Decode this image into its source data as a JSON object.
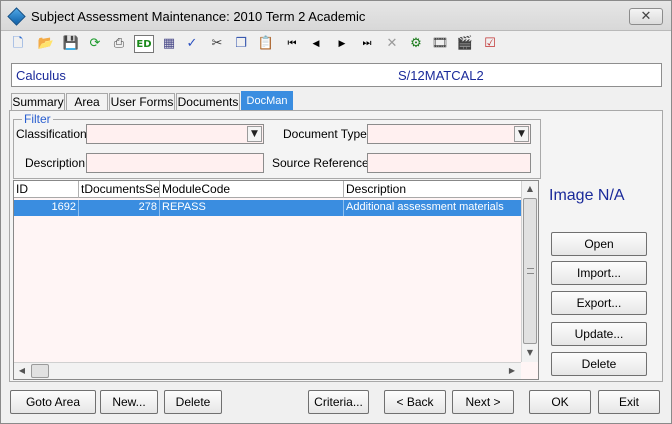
{
  "window": {
    "title": "Subject Assessment Maintenance:  2010 Term 2 Academic",
    "close_glyph": "✕"
  },
  "toolbar": [
    {
      "name": "new-icon",
      "glyph": "🗋",
      "color": "#2a6ad0"
    },
    {
      "name": "open-folder-icon",
      "glyph": "📂",
      "color": "#d4a020"
    },
    {
      "name": "save-icon",
      "glyph": "💾",
      "color": "#9a9a9a"
    },
    {
      "name": "refresh-icon",
      "glyph": "⟳",
      "color": "#1a9a2a"
    },
    {
      "name": "print-icon",
      "glyph": "⎙",
      "color": "#444444"
    },
    {
      "name": "edit-icon",
      "glyph": "ED",
      "color": "#1a8a1a"
    },
    {
      "name": "calculator-icon",
      "glyph": "▦",
      "color": "#4a4a8a"
    },
    {
      "name": "spellcheck-icon",
      "glyph": "✓",
      "color": "#2a50c0"
    },
    {
      "name": "cut-icon",
      "glyph": "✂",
      "color": "#3a3a3a"
    },
    {
      "name": "copy-icon",
      "glyph": "❐",
      "color": "#3a5ab0"
    },
    {
      "name": "paste-icon",
      "glyph": "📋",
      "color": "#b08a30"
    },
    {
      "name": "first-record-icon",
      "glyph": "⏮",
      "color": "#000000"
    },
    {
      "name": "previous-record-icon",
      "glyph": "◀",
      "color": "#000000"
    },
    {
      "name": "next-record-icon",
      "glyph": "▶",
      "color": "#000000"
    },
    {
      "name": "last-record-icon",
      "glyph": "⏭",
      "color": "#000000"
    },
    {
      "name": "delete-record-icon",
      "glyph": "✕",
      "color": "#9a9a9a"
    },
    {
      "name": "network-icon",
      "glyph": "⚙",
      "color": "#1a7a1a"
    },
    {
      "name": "film-icon",
      "glyph": "🎞",
      "color": "#3a3a3a"
    },
    {
      "name": "clapper-icon",
      "glyph": "🎬",
      "color": "#c02020"
    },
    {
      "name": "checklist-icon",
      "glyph": "☑",
      "color": "#c03030"
    }
  ],
  "header": {
    "subject_name": "Calculus",
    "subject_code": "S/12MATCAL2"
  },
  "tabs": [
    {
      "label": "Summary",
      "active": false
    },
    {
      "label": "Area",
      "active": false
    },
    {
      "label": "User Forms",
      "active": false
    },
    {
      "label": "Documents",
      "active": false
    },
    {
      "label": "DocMan",
      "active": true
    }
  ],
  "filter": {
    "legend": "Filter",
    "classification_label": "Classification:",
    "classification_value": "",
    "document_type_label": "Document Type:",
    "document_type_value": "",
    "description_label": "Description:",
    "description_value": "",
    "source_reference_label": "Source Reference:",
    "source_reference_value": ""
  },
  "grid": {
    "columns": [
      "ID",
      "tDocumentsSeq",
      "ModuleCode",
      "Description"
    ],
    "rows": [
      [
        "1692",
        "278",
        "REPASS",
        "Additional assessment materials"
      ]
    ]
  },
  "image_placeholder": "Image N/A",
  "side_buttons": [
    "Open",
    "Import...",
    "Export...",
    "Update...",
    "Delete"
  ],
  "bottom_buttons": [
    {
      "name": "goto-area-button",
      "label": "Goto Area"
    },
    {
      "name": "new-button",
      "label": "New..."
    },
    {
      "name": "delete-button",
      "label": "Delete"
    },
    {
      "name": "criteria-button",
      "label": "Criteria..."
    },
    {
      "name": "back-button",
      "label": "< Back"
    },
    {
      "name": "next-button",
      "label": "Next >"
    },
    {
      "name": "ok-button",
      "label": "OK"
    },
    {
      "name": "exit-button",
      "label": "Exit"
    }
  ],
  "colors": {
    "accent": "#3a8de0",
    "label_blue": "#1a2a9a",
    "field_bg": "#fff0f0"
  }
}
